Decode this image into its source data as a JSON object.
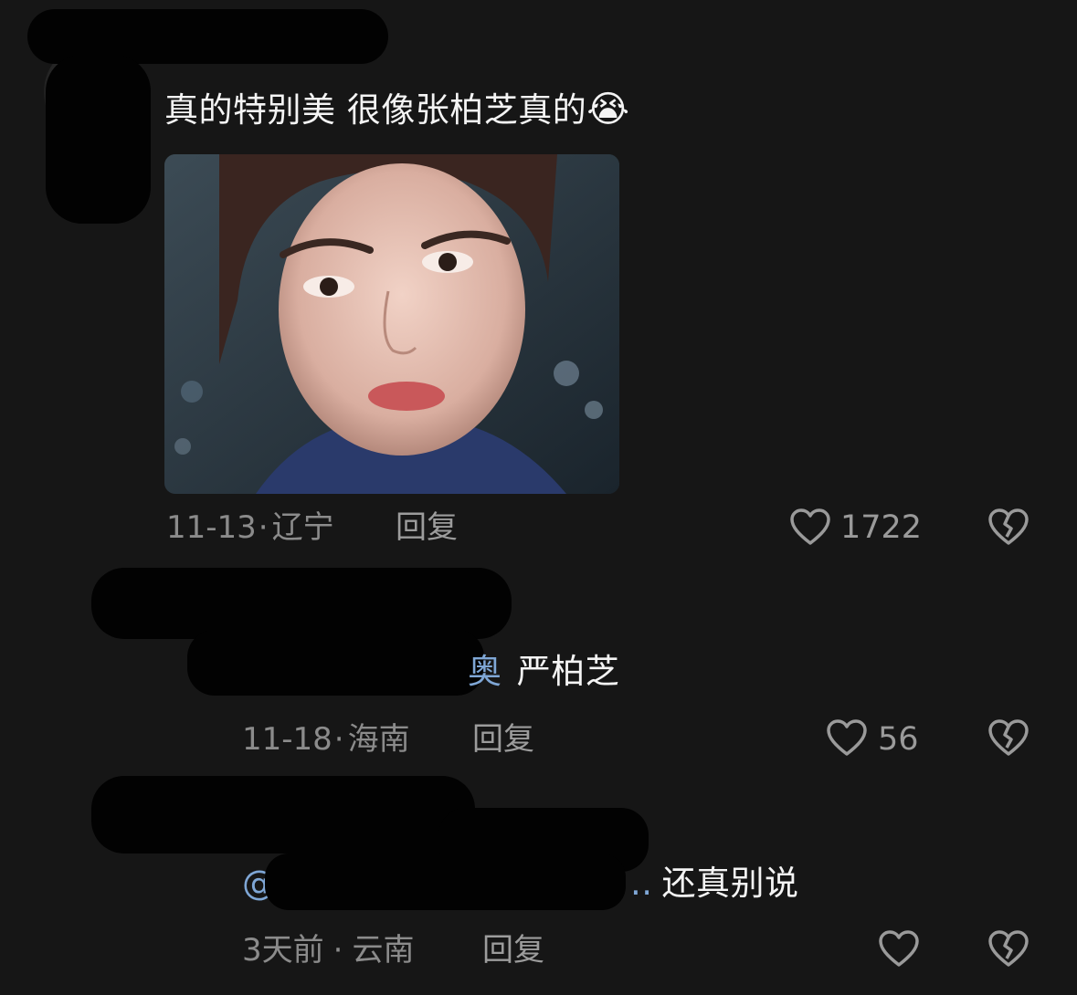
{
  "comments": [
    {
      "text": "真的特别美 很像张柏芝真的",
      "emoji": "😭",
      "date": "11-13",
      "separator": "·",
      "location": "辽宁",
      "reply_label": "回复",
      "likes": "1722"
    },
    {
      "mention_tail": "奥",
      "text": "严柏芝",
      "date": "11-18",
      "separator": "·",
      "location": "海南",
      "reply_label": "回复",
      "likes": "56"
    },
    {
      "mention_head": "@",
      "mention_tail": "..",
      "text": "还真别说",
      "date": "3天前",
      "separator": "·",
      "location": "云南",
      "reply_label": "回复",
      "likes": ""
    }
  ],
  "colors": {
    "background": "#161616",
    "text": "#f4f4f4",
    "meta": "#8b8b8b",
    "mention": "#7fa7d6"
  },
  "icons": {
    "like": "heart-outline-icon",
    "dislike": "broken-heart-icon"
  }
}
